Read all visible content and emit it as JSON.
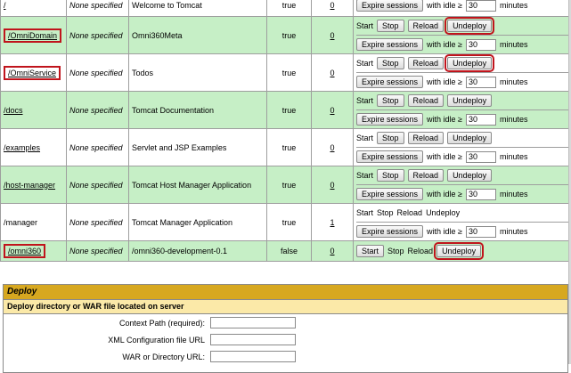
{
  "labels": {
    "start": "Start",
    "stop": "Stop",
    "reload": "Reload",
    "undeploy": "Undeploy",
    "expire": "Expire sessions",
    "with_idle": "with idle ≥",
    "minutes": "minutes"
  },
  "apps": [
    {
      "path": "/",
      "version": "None specified",
      "display": "Welcome to Tomcat",
      "running": "true",
      "sessions": "0",
      "idle": "30"
    },
    {
      "path": "/OmniDomain",
      "version": "None specified",
      "display": "Omni360Meta",
      "running": "true",
      "sessions": "0",
      "idle": "30"
    },
    {
      "path": "/OmniService",
      "version": "None specified",
      "display": "Todos",
      "running": "true",
      "sessions": "0",
      "idle": "30"
    },
    {
      "path": "/docs",
      "version": "None specified",
      "display": "Tomcat Documentation",
      "running": "true",
      "sessions": "0",
      "idle": "30"
    },
    {
      "path": "/examples",
      "version": "None specified",
      "display": "Servlet and JSP Examples",
      "running": "true",
      "sessions": "0",
      "idle": "30"
    },
    {
      "path": "/host-manager",
      "version": "None specified",
      "display": "Tomcat Host Manager Application",
      "running": "true",
      "sessions": "0",
      "idle": "30"
    },
    {
      "path": "/manager",
      "version": "None specified",
      "display": "Tomcat Manager Application",
      "running": "true",
      "sessions": "1",
      "idle": "30"
    },
    {
      "path": "/omni360",
      "version": "None specified",
      "display": "/omni360-development-0.1",
      "running": "false",
      "sessions": "0"
    }
  ],
  "deploy": {
    "title": "Deploy",
    "subtitle": "Deploy directory or WAR file located on server",
    "context_path_label": "Context Path (required):",
    "xml_config_label": "XML Configuration file URL",
    "war_dir_label": "WAR or Directory URL:"
  }
}
